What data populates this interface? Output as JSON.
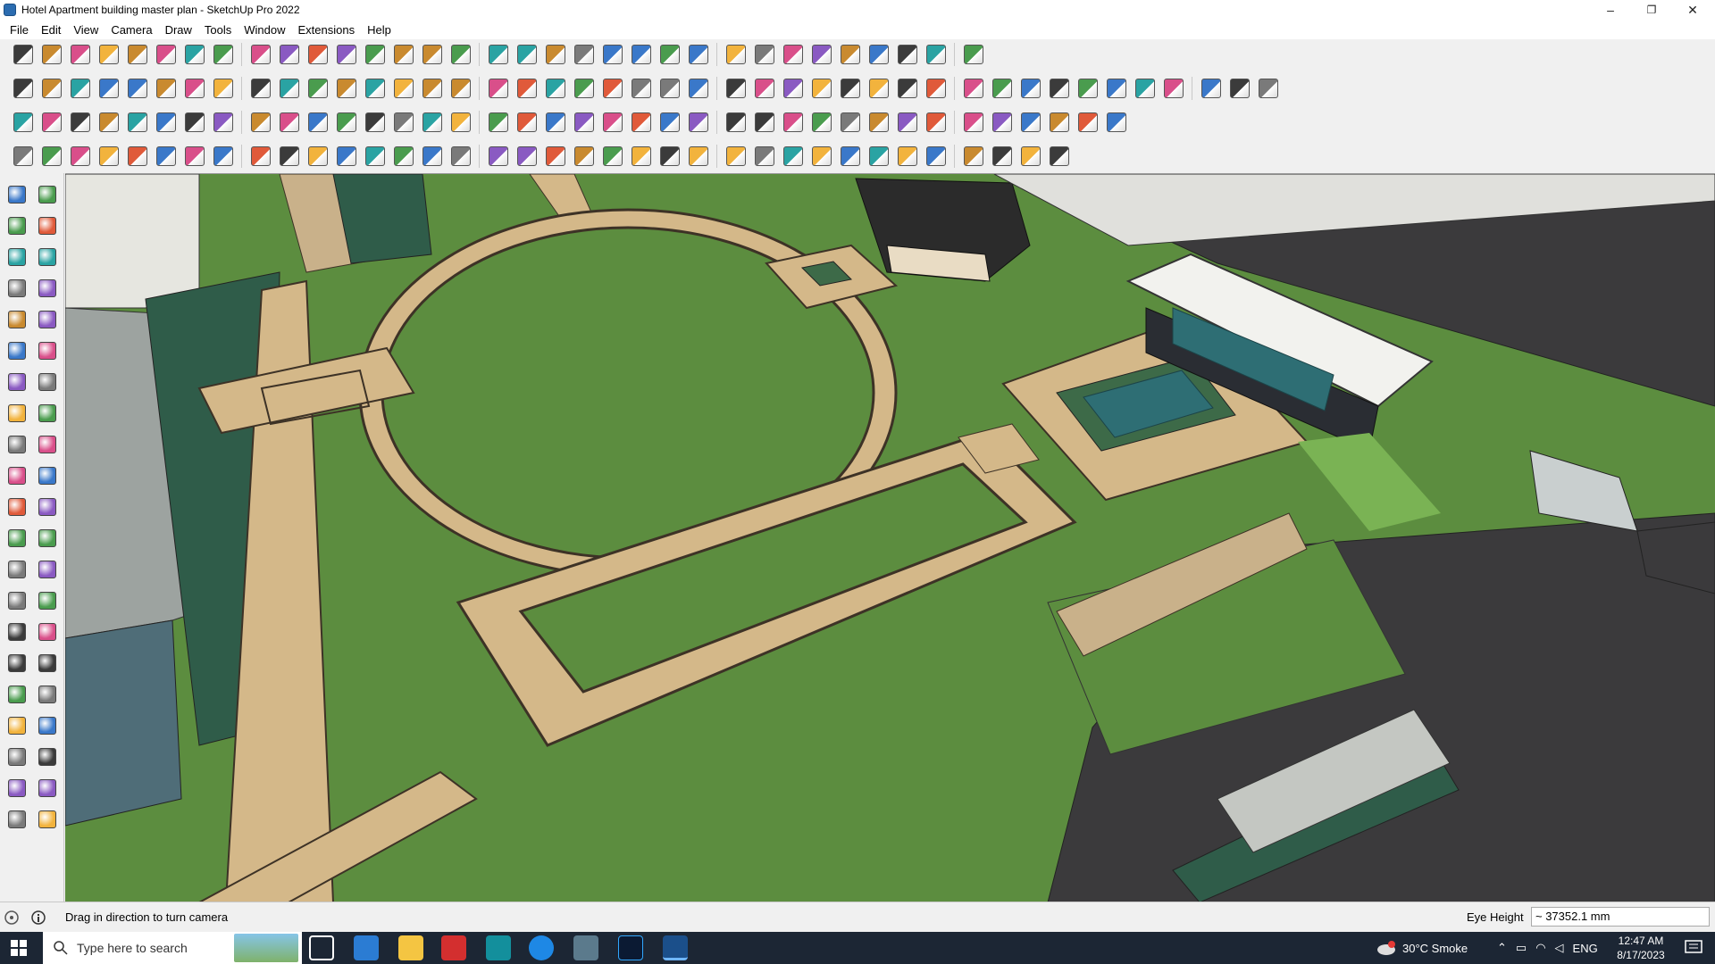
{
  "window": {
    "title": "Hotel Apartment building master plan - SketchUp Pro 2022",
    "minimize": "–",
    "restore": "❐",
    "close": "✕"
  },
  "menu": [
    "File",
    "Edit",
    "View",
    "Camera",
    "Draw",
    "Tools",
    "Window",
    "Extensions",
    "Help"
  ],
  "toolbar_rows": {
    "row1": [
      "zoom-icon",
      "select-icon",
      "eraser-icon",
      "pencil-icon",
      "lasso-icon",
      "paint-icon",
      "push-pull-icon",
      "follow-me-icon",
      "move-icon",
      "rotate-icon",
      "scale-icon",
      "tape-measure-icon",
      "text-icon",
      "paint-bucket-icon",
      "orbit-icon",
      "pan-icon",
      "zoom-tool-icon",
      "zoom-extents-icon",
      "section-icon",
      "warehouse-icon",
      "layers-icon",
      "extension-icon",
      "user-icon",
      "style-icon",
      "component-icon",
      "sandbox-icon",
      "arrow-up-icon",
      "arrow-down-icon",
      "measure-icon",
      "geo-icon",
      "undo-icon",
      "redo-icon",
      "flag-icon"
    ],
    "row2": [
      "box-icon",
      "solid-icon",
      "sphere-icon",
      "push-icon",
      "plane-x-icon",
      "plane-y-icon",
      "plane-z-icon",
      "plane-v-icon",
      "plane-n-icon",
      "plane-h-icon",
      "plane-f-icon",
      "curve-icon",
      "mirror-icon",
      "shear-icon",
      "skew-icon",
      "terrain-icon",
      "flatten-icon",
      "house-icon",
      "wall-icon",
      "home-icon",
      "roof-icon",
      "door-icon",
      "formula-icon",
      "leaf-icon",
      "knife-icon",
      "rect-icon",
      "circle-icon",
      "hexagon-icon",
      "ellipse-icon",
      "parallelogram-icon",
      "arc-icon",
      "polygon-icon",
      "shape-icon",
      "spline-icon",
      "revolve-icon",
      "gear-cut-icon",
      "brush-icon",
      "box-3d-icon",
      "grid-icon",
      "stairs-icon",
      "frame-icon",
      "roof-2-icon",
      "pyramid-icon"
    ],
    "row3": [
      "face-blue-icon",
      "face-blue-2-icon",
      "face-tan-icon",
      "text-label-icon",
      "close-small-icon",
      "paint-red-icon",
      "arc-orange-icon",
      "rect-red-icon",
      "stack-icon",
      "panel-icon",
      "beam-icon",
      "line-dash-icon",
      "dot-line-icon",
      "cross-red-icon",
      "cross-green-icon",
      "cross-blue-icon",
      "cone-icon",
      "tree-icon",
      "triangle-icon",
      "curl-icon",
      "scissors-icon",
      "spiral-icon",
      "move-small-icon",
      "bucket-icon",
      "hook-icon",
      "recycle-icon",
      "export-icon",
      "connect-icon",
      "join-icon",
      "cube-red-icon",
      "explode-icon",
      "window-icon",
      "tile-icon",
      "tile-2-icon",
      "tile-3-icon",
      "shrink-icon",
      "circle-dash-icon",
      "split-icon"
    ],
    "row4": [
      "draw-line-icon",
      "polyline-icon",
      "car-icon",
      "dot-icon",
      "bend-icon",
      "cylinder-icon",
      "twist-icon",
      "fold-icon",
      "corner-icon",
      "corner-2-icon",
      "trim-icon",
      "fillet-icon",
      "tube-icon",
      "warp-icon",
      "fence-icon",
      "cage-icon",
      "hand-icon",
      "curve-2-icon",
      "fold-2-icon",
      "lattice-icon",
      "slope-icon",
      "shear-2-icon",
      "stretch-icon",
      "pin-icon",
      "ribbon-icon",
      "mesh-icon",
      "bridge-icon",
      "grate-icon",
      "pattern-icon",
      "lines-icon",
      "bars-icon",
      "gear-2-icon",
      "gear-3-icon",
      "plane-tilt-icon",
      "spring-icon",
      "tree-2-icon"
    ]
  },
  "left_toolbar": [
    "select-icon",
    "orbit-icon",
    "paint-bucket-icon",
    "eraser-icon",
    "component-icon",
    "pencil-icon",
    "line-icon",
    "freehand-icon",
    "rectangle-icon",
    "rotated-rect-icon",
    "circle-icon",
    "polygon-icon",
    "arc-icon",
    "pie-icon",
    "three-point-arc-icon",
    "two-point-arc-icon",
    "move-icon",
    "push-pull-icon",
    "rotate-icon",
    "follow-me-icon",
    "scale-icon",
    "offset-icon",
    "tape-measure-icon",
    "dimension-icon",
    "protractor-icon",
    "text-icon",
    "axes-icon",
    "3d-text-icon",
    "orbit-tool-icon",
    "pan-icon",
    "zoom-icon",
    "zoom-window-icon",
    "zoom-extents-icon",
    "previous-view-icon",
    "position-camera-icon",
    "look-around-icon",
    "walk-icon",
    "section-plane-icon",
    "section-display-icon",
    "section-fill-icon",
    "section-cuts-icon",
    "section-planes-icon"
  ],
  "status": {
    "message": "Drag in direction to turn camera",
    "eye_height_label": "Eye Height",
    "eye_height_value": "~ 37352.1 mm"
  },
  "taskbar": {
    "search_placeholder": "Type here to search",
    "weather": "30°C  Smoke",
    "language": "ENG",
    "time": "12:47 AM",
    "date": "8/17/2023"
  },
  "colors": {
    "grass": "#5c8d3f",
    "path": "#d4b889",
    "path_edge": "#3d3226",
    "road": "#3b3a3c",
    "water": "#2e6e74",
    "building": "#f2f2ee"
  }
}
